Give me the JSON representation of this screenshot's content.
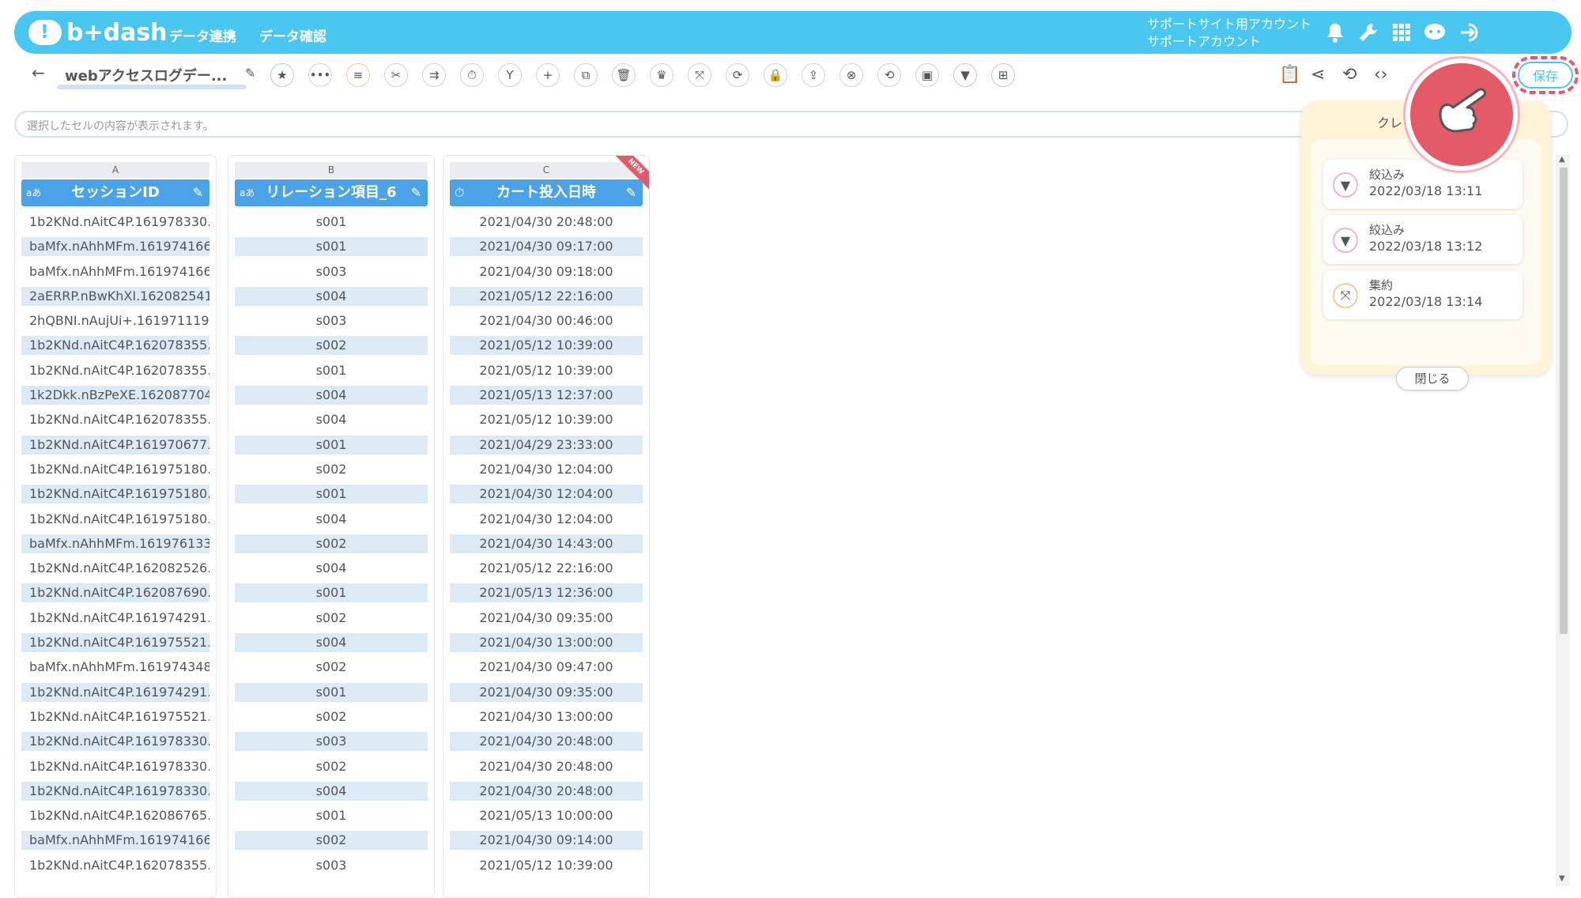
{
  "header": {
    "logo_text": "b+dash",
    "nav": [
      "データ連携",
      "データ確認"
    ],
    "account_line1": "サポートサイト用アカウント",
    "account_line2": "サポートアカウント"
  },
  "toolbar": {
    "title": "webアクセスログデー...",
    "save_label": "保存"
  },
  "cellbar": {
    "placeholder": "選択したセルの内容が表示されます。"
  },
  "columns": [
    {
      "letter": "A",
      "name": "セッションID",
      "type_icon": "aあ"
    },
    {
      "letter": "B",
      "name": "リレーション項目_6",
      "type_icon": "aあ"
    },
    {
      "letter": "C",
      "name": "カート投入日時",
      "type_icon": "⏱",
      "badge": "NEW"
    }
  ],
  "rows": [
    [
      "1b2KNd.nAitC4P.161978330...",
      "s001",
      "2021/04/30 20:48:00"
    ],
    [
      "baMfx.nAhhMFm.161974166...",
      "s001",
      "2021/04/30 09:17:00"
    ],
    [
      "baMfx.nAhhMFm.161974166...",
      "s003",
      "2021/04/30 09:18:00"
    ],
    [
      "2aERRP.nBwKhXI.162082541...",
      "s004",
      "2021/05/12 22:16:00"
    ],
    [
      "2hQBNI.nAujUi+.161971119...",
      "s003",
      "2021/04/30 00:46:00"
    ],
    [
      "1b2KNd.nAitC4P.162078355...",
      "s002",
      "2021/05/12 10:39:00"
    ],
    [
      "1b2KNd.nAitC4P.162078355...",
      "s001",
      "2021/05/12 10:39:00"
    ],
    [
      "1k2Dkk.nBzPeXE.162087704...",
      "s004",
      "2021/05/13 12:37:00"
    ],
    [
      "1b2KNd.nAitC4P.162078355...",
      "s004",
      "2021/05/12 10:39:00"
    ],
    [
      "1b2KNd.nAitC4P.161970677...",
      "s001",
      "2021/04/29 23:33:00"
    ],
    [
      "1b2KNd.nAitC4P.161975180...",
      "s002",
      "2021/04/30 12:04:00"
    ],
    [
      "1b2KNd.nAitC4P.161975180...",
      "s001",
      "2021/04/30 12:04:00"
    ],
    [
      "1b2KNd.nAitC4P.161975180...",
      "s004",
      "2021/04/30 12:04:00"
    ],
    [
      "baMfx.nAhhMFm.161976133...",
      "s002",
      "2021/04/30 14:43:00"
    ],
    [
      "1b2KNd.nAitC4P.162082526...",
      "s004",
      "2021/05/12 22:16:00"
    ],
    [
      "1b2KNd.nAitC4P.162087690...",
      "s001",
      "2021/05/13 12:36:00"
    ],
    [
      "1b2KNd.nAitC4P.161974291...",
      "s002",
      "2021/04/30 09:35:00"
    ],
    [
      "1b2KNd.nAitC4P.161975521...",
      "s004",
      "2021/04/30 13:00:00"
    ],
    [
      "baMfx.nAhhMFm.161974348...",
      "s002",
      "2021/04/30 09:47:00"
    ],
    [
      "1b2KNd.nAitC4P.161974291...",
      "s001",
      "2021/04/30 09:35:00"
    ],
    [
      "1b2KNd.nAitC4P.161975521...",
      "s002",
      "2021/04/30 13:00:00"
    ],
    [
      "1b2KNd.nAitC4P.161978330...",
      "s003",
      "2021/04/30 20:48:00"
    ],
    [
      "1b2KNd.nAitC4P.161978330...",
      "s002",
      "2021/04/30 20:48:00"
    ],
    [
      "1b2KNd.nAitC4P.161978330...",
      "s004",
      "2021/04/30 20:48:00"
    ],
    [
      "1b2KNd.nAitC4P.162086765...",
      "s001",
      "2021/05/13 10:00:00"
    ],
    [
      "baMfx.nAhhMFm.161974166...",
      "s002",
      "2021/04/30 09:14:00"
    ],
    [
      "1b2KNd.nAitC4P.162078355...",
      "s003",
      "2021/05/12 10:39:00"
    ]
  ],
  "history_panel": {
    "title": "クレ",
    "items": [
      {
        "name": "絞込み",
        "date": "2022/03/18 13:11",
        "icon": "filter-icon"
      },
      {
        "name": "絞込み",
        "date": "2022/03/18 13:12",
        "icon": "filter-icon"
      },
      {
        "name": "集約",
        "date": "2022/03/18 13:14",
        "icon": "aggregate-icon"
      }
    ],
    "close_label": "閉じる"
  },
  "colors": {
    "brand": "#4ac6f2",
    "column_header": "#4aa3e8",
    "alt_row": "#dceaf6",
    "accent_red": "#e25b67"
  }
}
